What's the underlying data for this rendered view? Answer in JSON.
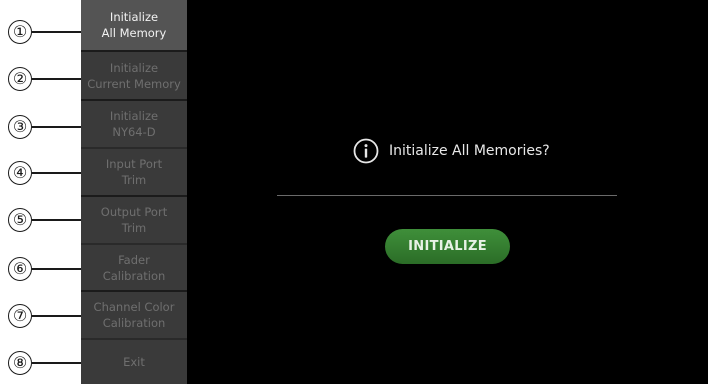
{
  "callouts": [
    "①",
    "②",
    "③",
    "④",
    "⑤",
    "⑥",
    "⑦",
    "⑧"
  ],
  "sidebar": {
    "items": [
      {
        "line1": "Initialize",
        "line2": "All Memory",
        "active": true
      },
      {
        "line1": "Initialize",
        "line2": "Current Memory",
        "active": false
      },
      {
        "line1": "Initialize",
        "line2": "NY64-D",
        "active": false
      },
      {
        "line1": "Input Port",
        "line2": "Trim",
        "active": false
      },
      {
        "line1": "Output Port",
        "line2": "Trim",
        "active": false
      },
      {
        "line1": "Fader",
        "line2": "Calibration",
        "active": false
      },
      {
        "line1": "Channel Color",
        "line2": "Calibration",
        "active": false
      },
      {
        "line1": "Exit",
        "line2": "",
        "active": false
      }
    ]
  },
  "main": {
    "icon": "info-icon",
    "message": "Initialize All Memories?",
    "button_label": "INITIALIZE"
  },
  "colors": {
    "screen_bg": "#000000",
    "sidebar_bg": "#3a3a3a",
    "active_item_bg": "#545454",
    "button_green": "#3a8a35"
  }
}
